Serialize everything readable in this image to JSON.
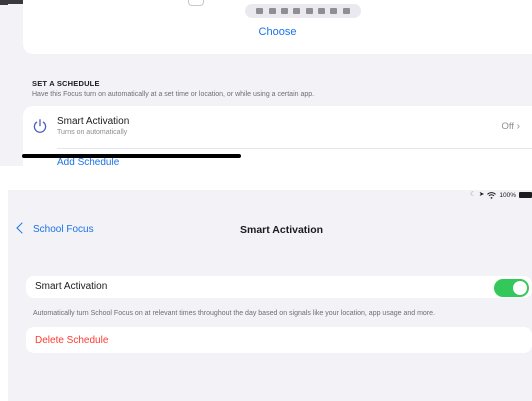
{
  "top_screen": {
    "choose_label": "Choose",
    "schedule_section_title": "SET A SCHEDULE",
    "schedule_section_desc": "Have this Focus turn on automatically at a set time or location, or while using a certain app.",
    "smart_activation_row": {
      "title": "Smart Activation",
      "subtitle": "Turns on automatically",
      "value": "Off",
      "icon": "power-icon"
    },
    "add_schedule_label": "Add Schedule"
  },
  "status_bar": {
    "icons": [
      "moon-icon",
      "location-icon",
      "wifi-icon"
    ],
    "battery_text": "100%"
  },
  "nav": {
    "back_label": "School Focus",
    "title": "Smart Activation"
  },
  "smart_activation": {
    "toggle_label": "Smart Activation",
    "toggle_on": true,
    "description": "Automatically turn School Focus on at relevant times throughout the day based on signals like your location, app usage and more.",
    "delete_label": "Delete Schedule"
  },
  "colors": {
    "accent": "#1a73e8",
    "toggle_on": "#34c759",
    "destructive": "#ff3b30",
    "background": "#f2f2f7"
  }
}
